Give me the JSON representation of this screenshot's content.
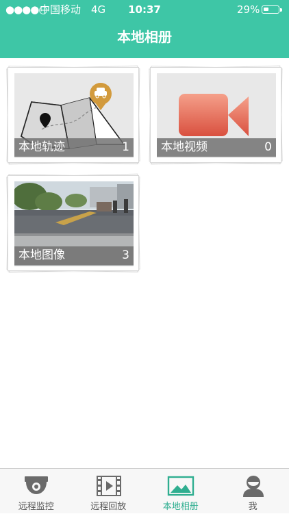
{
  "status_bar": {
    "signal": "●●●●○",
    "carrier": "中国移动",
    "network": "4G",
    "time": "10:37",
    "battery": "29%"
  },
  "header": {
    "title": "本地相册"
  },
  "albums": [
    {
      "name": "本地轨迹",
      "count": "1",
      "thumb_icon": "map-route-icon"
    },
    {
      "name": "本地视频",
      "count": "0",
      "thumb_icon": "video-camera-icon"
    },
    {
      "name": "本地图像",
      "count": "3",
      "thumb_icon": "street-photo"
    }
  ],
  "tabs": [
    {
      "label": "远程监控",
      "icon": "security-camera-icon",
      "active": false
    },
    {
      "label": "远程回放",
      "icon": "film-play-icon",
      "active": false
    },
    {
      "label": "本地相册",
      "icon": "album-image-icon",
      "active": true
    },
    {
      "label": "我",
      "icon": "user-avatar-icon",
      "active": false
    }
  ],
  "colors": {
    "accent": "#3ec6a6",
    "active_tab": "#2fae90",
    "caption_bg": "#6e6e6e",
    "pin": "#d29a3c",
    "video_icon": "#e8705a"
  }
}
